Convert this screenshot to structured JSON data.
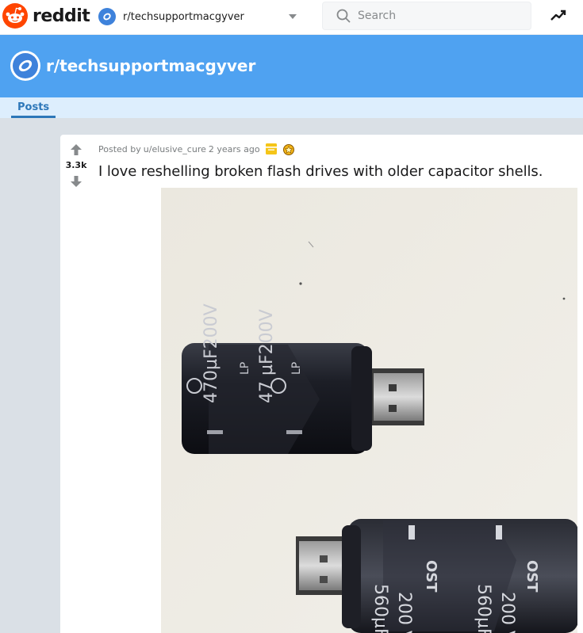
{
  "header": {
    "logo_text": "reddit",
    "subreddit_selector": "r/techsupportmacgyver",
    "search_placeholder": "Search"
  },
  "banner": {
    "title": "r/techsupportmacgyver"
  },
  "tabs": [
    {
      "label": "Posts"
    }
  ],
  "post": {
    "score": "3.3k",
    "posted_by_prefix": "Posted by",
    "author": "u/elusive_cure",
    "time": "2 years ago",
    "title": "I love reshelling broken flash drives with older capacitor shells.",
    "image_alt": "Two USB flash drives housed inside black electrolytic capacitor shells on a white surface"
  },
  "colors": {
    "brand_orange": "#ff4500",
    "banner_blue": "#4fa2f1",
    "tab_blue": "#2d77b9"
  }
}
